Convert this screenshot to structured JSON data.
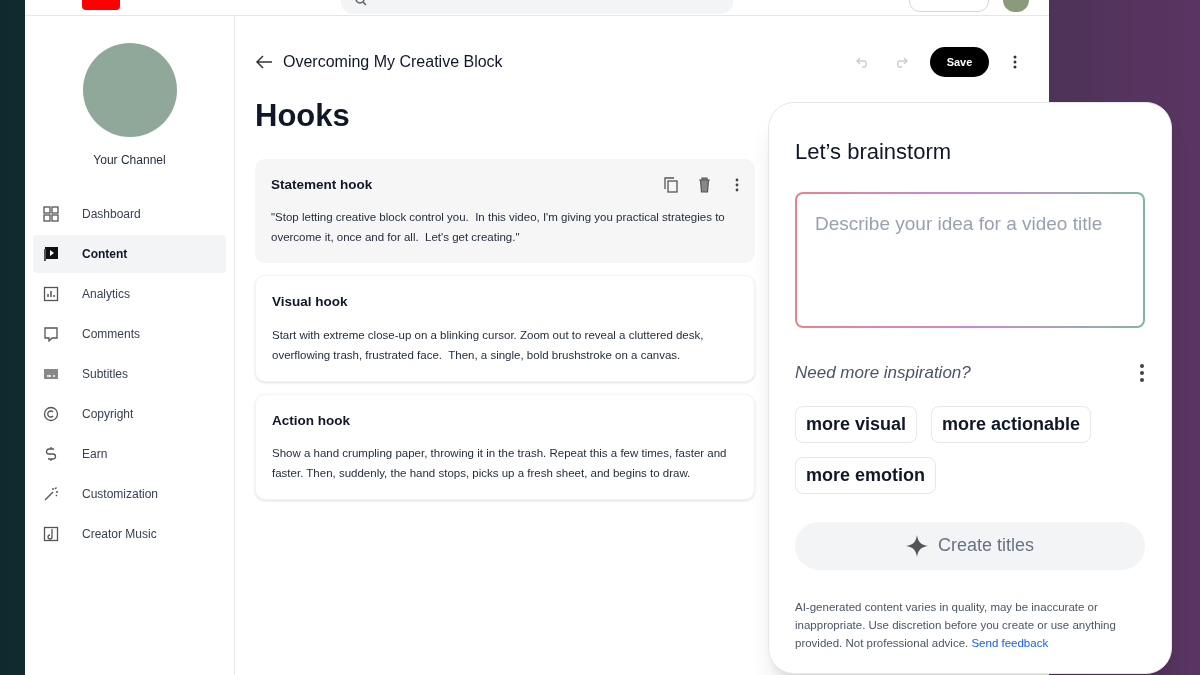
{
  "channel": {
    "name": "Your Channel"
  },
  "sidebar": {
    "items": [
      {
        "label": "Dashboard",
        "kind": "dashboard",
        "selected": false
      },
      {
        "label": "Content",
        "kind": "content",
        "selected": true
      },
      {
        "label": "Analytics",
        "kind": "analytics",
        "selected": false
      },
      {
        "label": "Comments",
        "kind": "comments",
        "selected": false
      },
      {
        "label": "Subtitles",
        "kind": "subtitles",
        "selected": false
      },
      {
        "label": "Copyright",
        "kind": "copyright",
        "selected": false
      },
      {
        "label": "Earn",
        "kind": "earn",
        "selected": false
      },
      {
        "label": "Customization",
        "kind": "customization",
        "selected": false
      },
      {
        "label": "Creator Music",
        "kind": "music",
        "selected": false
      }
    ]
  },
  "header": {
    "title": "Overcoming My Creative Block",
    "save": "Save"
  },
  "page_title": "Hooks",
  "hooks": [
    {
      "title": "Statement hook",
      "text": "\"Stop letting creative block control you.  In this video, I'm giving you practical strategies to overcome it, once and for all.  Let's get creating.\"",
      "selected": true
    },
    {
      "title": "Visual hook",
      "text": "Start with extreme close-up on a blinking cursor. Zoom out to reveal a cluttered desk, overflowing trash, frustrated face.  Then, a single, bold brushstroke on a canvas.",
      "selected": false
    },
    {
      "title": "Action hook",
      "text": "Show a hand crumpling paper, throwing it in the trash. Repeat this a few times, faster and faster. Then, suddenly, the hand stops, picks up a fresh sheet, and begins to draw.",
      "selected": false
    }
  ],
  "brainstorm": {
    "title": "Let’s brainstorm",
    "placeholder": "Describe your idea for a video title",
    "inspiration": "Need more inspiration?",
    "chips": [
      "more visual",
      "more actionable",
      "more emotion"
    ],
    "create": "Create titles",
    "create_disabled": true,
    "disclaimer": "AI-generated content varies in quality, may be inaccurate or inappropriate. Use discretion before you create or use anything provided. Not professional advice.",
    "feedback": "Send feedback"
  }
}
